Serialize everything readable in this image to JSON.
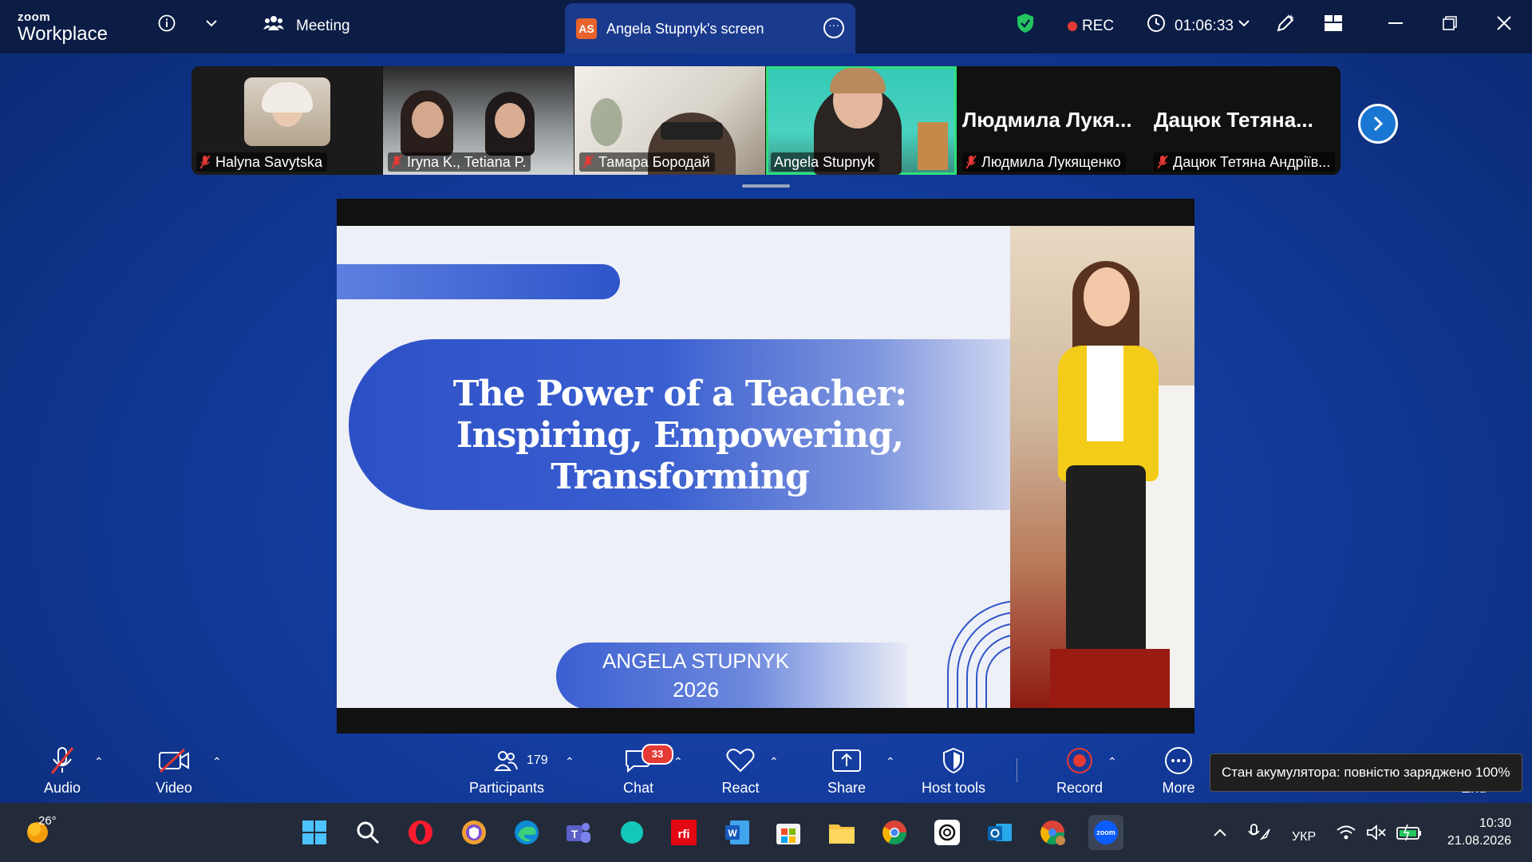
{
  "app": {
    "logo_line1": "zoom",
    "logo_line2": "Workplace"
  },
  "topbar": {
    "meeting_label": "Meeting",
    "tab_initials": "AS",
    "tab_title": "Angela Stupnyk's screen",
    "rec_label": "REC",
    "timer": "01:06:33"
  },
  "gallery": {
    "tiles": [
      {
        "name": "Halyna Savytska"
      },
      {
        "name": "Iryna K., Tetiana P."
      },
      {
        "name": "Тамара Бородай"
      },
      {
        "name": "Angela Stupnyk"
      },
      {
        "name": "Людмила Лукященко",
        "big": "Людмила Лукя..."
      },
      {
        "name": "Дацюк Тетяна Андріїв...",
        "big": "Дацюк Тетяна..."
      }
    ]
  },
  "slide": {
    "title": "The Power of a Teacher: Inspiring, Empowering, Transforming",
    "author": "ANGELA STUPNYK",
    "year": "2026"
  },
  "toolbar": {
    "audio": "Audio",
    "video": "Video",
    "participants": "Participants",
    "participants_count": "179",
    "chat": "Chat",
    "chat_badge": "33",
    "react": "React",
    "share": "Share",
    "host_tools": "Host tools",
    "record": "Record",
    "more": "More",
    "end": "End",
    "tooltip": "Стан акумулятора: повністю заряджено 100%"
  },
  "taskbar": {
    "temperature": "26°",
    "language": "УКР",
    "time": "10:30",
    "date": "21.08.2026"
  },
  "colors": {
    "accent": "#2d50c7",
    "active_speaker": "#2ee07a",
    "record_red": "#e53935",
    "topbar_bg": "#0b1d45"
  }
}
